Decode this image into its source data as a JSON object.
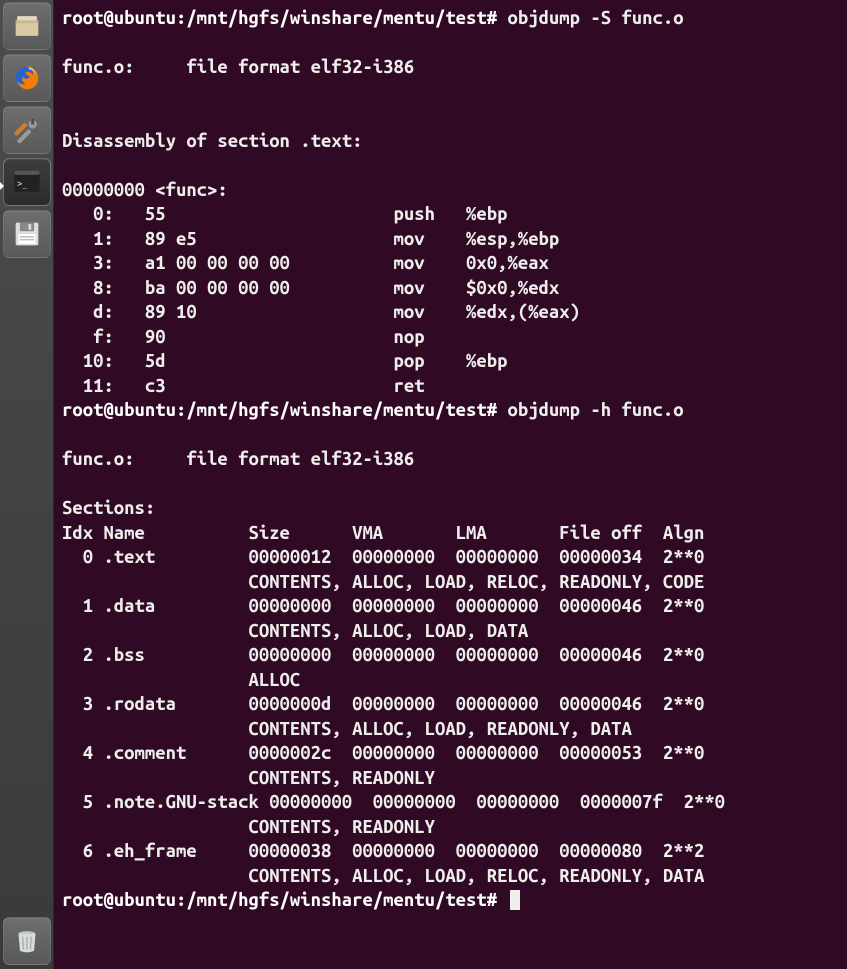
{
  "launcher": {
    "items": [
      {
        "name": "files-icon"
      },
      {
        "name": "firefox-icon"
      },
      {
        "name": "settings-icon"
      },
      {
        "name": "terminal-icon"
      },
      {
        "name": "save-icon"
      }
    ],
    "trash": {
      "name": "trash-icon"
    }
  },
  "terminal": {
    "prompt1_path": "root@ubuntu:/mnt/hgfs/winshare/mentu/test#",
    "cmd1": " objdump -S func.o",
    "blank": "",
    "fileinfo1": "func.o:     file format elf32-i386",
    "disasm_header": "Disassembly of section .text:",
    "func_label": "00000000 <func>:",
    "d0": "   0:   55                      push   %ebp",
    "d1": "   1:   89 e5                   mov    %esp,%ebp",
    "d3": "   3:   a1 00 00 00 00          mov    0x0,%eax",
    "d8": "   8:   ba 00 00 00 00          mov    $0x0,%edx",
    "dd": "   d:   89 10                   mov    %edx,(%eax)",
    "df": "   f:   90                      nop",
    "d10": "  10:   5d                      pop    %ebp",
    "d11": "  11:   c3                      ret    ",
    "prompt2_path": "root@ubuntu:/mnt/hgfs/winshare/mentu/test#",
    "cmd2": " objdump -h func.o",
    "fileinfo2": "func.o:     file format elf32-i386",
    "sections_header": "Sections:",
    "sec_cols": "Idx Name          Size      VMA       LMA       File off  Algn",
    "s0a": "  0 .text         00000012  00000000  00000000  00000034  2**0",
    "s0b": "                  CONTENTS, ALLOC, LOAD, RELOC, READONLY, CODE",
    "s1a": "  1 .data         00000000  00000000  00000000  00000046  2**0",
    "s1b": "                  CONTENTS, ALLOC, LOAD, DATA",
    "s2a": "  2 .bss          00000000  00000000  00000000  00000046  2**0",
    "s2b": "                  ALLOC",
    "s3a": "  3 .rodata       0000000d  00000000  00000000  00000046  2**0",
    "s3b": "                  CONTENTS, ALLOC, LOAD, READONLY, DATA",
    "s4a": "  4 .comment      0000002c  00000000  00000000  00000053  2**0",
    "s4b": "                  CONTENTS, READONLY",
    "s5a": "  5 .note.GNU-stack 00000000  00000000  00000000  0000007f  2**0",
    "s5b": "                  CONTENTS, READONLY",
    "s6a": "  6 .eh_frame     00000038  00000000  00000000  00000080  2**2",
    "s6b": "                  CONTENTS, ALLOC, LOAD, RELOC, READONLY, DATA",
    "prompt3_path": "root@ubuntu:/mnt/hgfs/winshare/mentu/test#",
    "cmd3": " "
  }
}
